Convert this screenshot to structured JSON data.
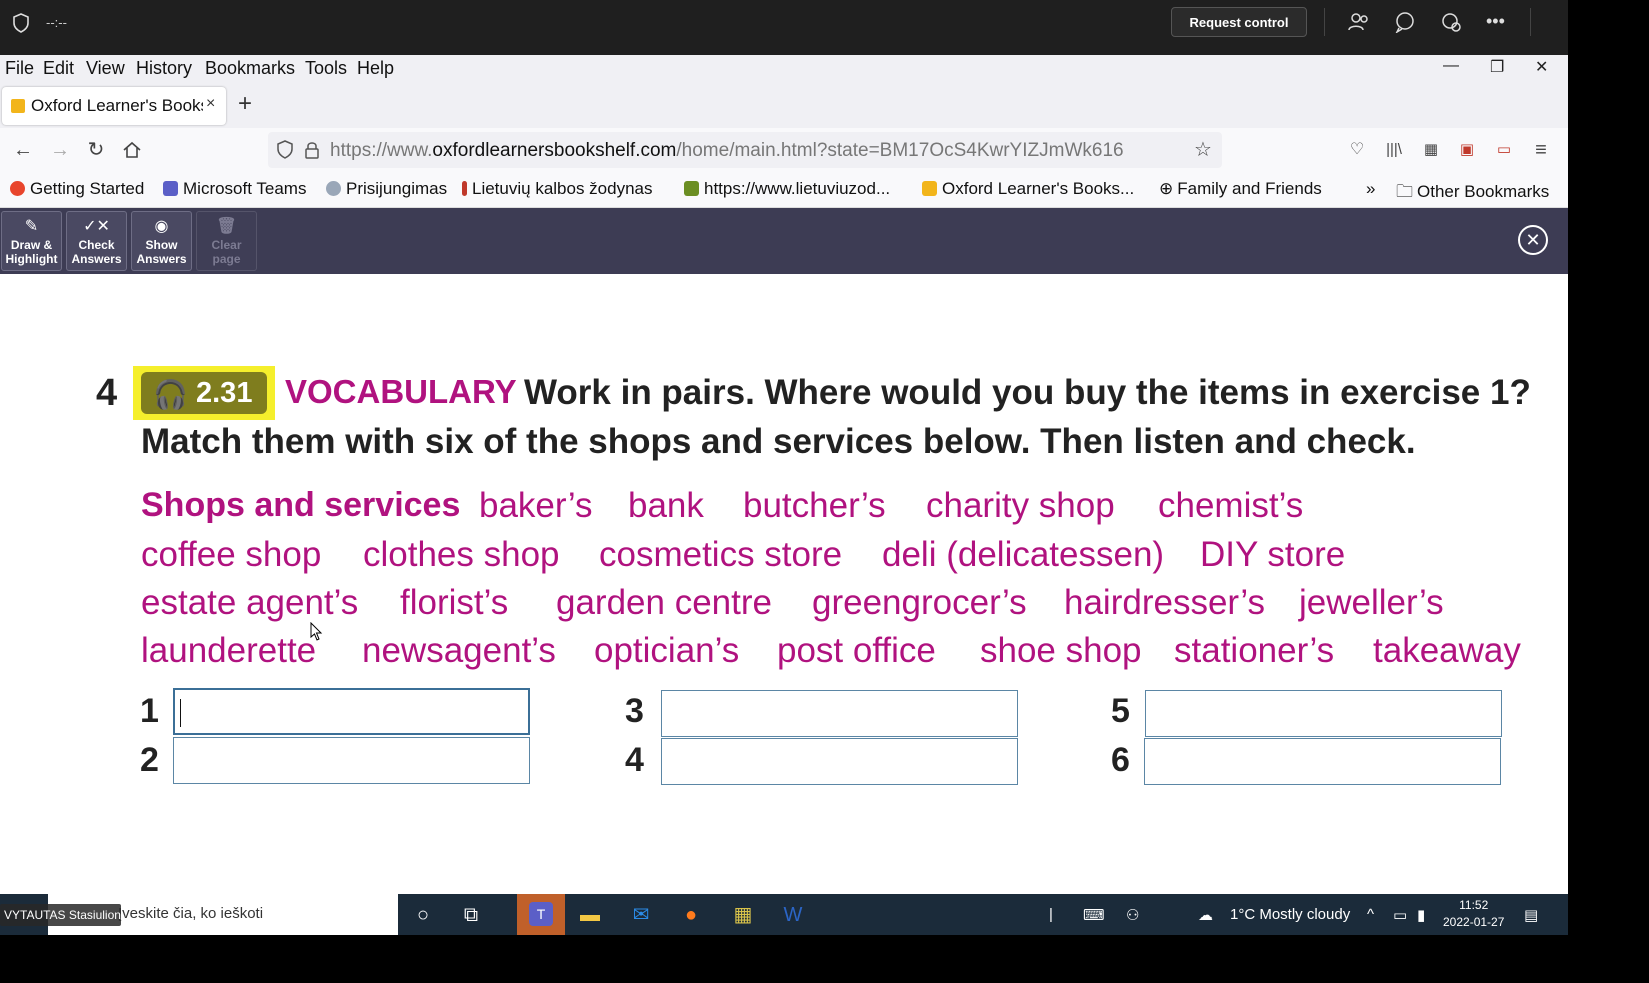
{
  "teams_bar": {
    "timer": "--:--",
    "request_control_label": "Request control",
    "icons": [
      "participants-icon",
      "chat-icon",
      "reactions-icon",
      "more-icon"
    ]
  },
  "menu": {
    "items": [
      "File",
      "Edit",
      "View",
      "History",
      "Bookmarks",
      "Tools",
      "Help"
    ]
  },
  "tab": {
    "title": "Oxford Learner's Bookshelf",
    "close_label": "×",
    "new_tab_label": "+"
  },
  "nav": {
    "url_prefix": "https://www.",
    "url_domain": "oxfordlearnersbookshelf.com",
    "url_path": "/home/main.html?state=BM17OcS4KwrYIZJmWk616"
  },
  "bookmarks": {
    "items": [
      {
        "label": "Getting Started",
        "color": "#e8452c"
      },
      {
        "label": "Microsoft Teams",
        "color": "#5b5fc7"
      },
      {
        "label": "Prisijungimas",
        "color": "#9aa7b8"
      },
      {
        "label": "Lietuvių kalbos žodynas",
        "color": "#c0392b"
      },
      {
        "label": "https://www.lietuviuzod...",
        "color": "#6b8e23"
      },
      {
        "label": "Oxford Learner's Books...",
        "color": "#f2b51b"
      },
      {
        "label": "Family and Friends",
        "color": "#666666"
      }
    ],
    "overflow_label": "»",
    "other_label": "Other Bookmarks"
  },
  "ox_toolbar": {
    "draw": "Draw & Highlight",
    "check": "Check Answers",
    "show": "Show Answers",
    "clear": "Clear page"
  },
  "exercise": {
    "number": "4",
    "audio_track": "2.31",
    "section": "VOCABULARY",
    "instruction_line1": "Work in pairs. Where would you buy the items in exercise 1?",
    "instruction_line2": "Match them with six of the shops and services below. Then listen and check.",
    "shops_title": "Shops and services",
    "words": [
      "baker’s",
      "bank",
      "butcher’s",
      "charity shop",
      "chemist’s",
      "coffee shop",
      "clothes shop",
      "cosmetics store",
      "deli (delicatessen)",
      "DIY store",
      "estate agent’s",
      "florist’s",
      "garden centre",
      "greengrocer’s",
      "hairdresser’s",
      "jeweller’s",
      "launderette",
      "newsagent’s",
      "optician’s",
      "post office",
      "shoe shop",
      "stationer’s",
      "takeaway"
    ],
    "answers": [
      {
        "num": "1",
        "value": ""
      },
      {
        "num": "2",
        "value": ""
      },
      {
        "num": "3",
        "value": ""
      },
      {
        "num": "4",
        "value": ""
      },
      {
        "num": "5",
        "value": ""
      },
      {
        "num": "6",
        "value": ""
      }
    ],
    "accent_color": "#b0127f",
    "badge_color": "#f5ef2c"
  },
  "taskbar": {
    "user_name": "VYTAUTAS Stasiulionis",
    "search_placeholder": "Įveskite čia, ko ieškoti",
    "weather": "1°C  Mostly cloudy",
    "time": "11:52",
    "date": "2022-01-27"
  }
}
